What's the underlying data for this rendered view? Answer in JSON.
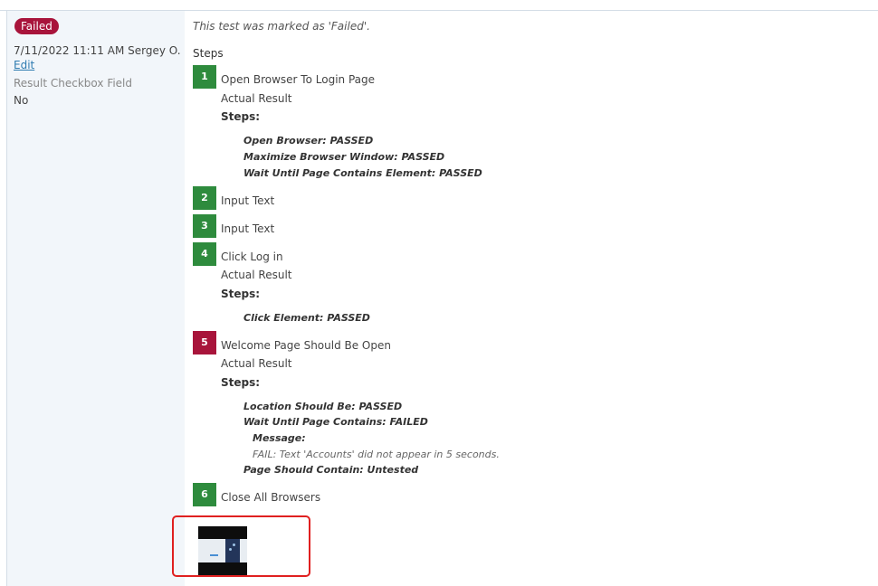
{
  "result": {
    "status_label": "Failed",
    "timestamp_user": "7/11/2022 11:11 AM Sergey O.",
    "edit_label": "Edit",
    "field_label": "Result Checkbox Field",
    "field_value": "No",
    "colors": {
      "failed": "#a8143b",
      "passed": "#2e8b3d"
    }
  },
  "main": {
    "status_note": "This test was marked as 'Failed'.",
    "steps_heading": "Steps",
    "steps": [
      {
        "number": "1",
        "status": "passed",
        "title": "Open Browser To Login Page",
        "actual_label": "Actual Result",
        "steps_label": "Steps:",
        "substeps": [
          "Open Browser: PASSED",
          "Maximize Browser Window: PASSED",
          "Wait Until Page Contains Element: PASSED"
        ]
      },
      {
        "number": "2",
        "status": "passed",
        "title": "Input Text"
      },
      {
        "number": "3",
        "status": "passed",
        "title": "Input Text"
      },
      {
        "number": "4",
        "status": "passed",
        "title": "Click Log in",
        "actual_label": "Actual Result",
        "steps_label": "Steps:",
        "substeps": [
          "Click Element: PASSED"
        ]
      },
      {
        "number": "5",
        "status": "failed",
        "title": "Welcome Page Should Be Open",
        "actual_label": "Actual Result",
        "steps_label": "Steps:",
        "substeps": [
          "Location Should Be: PASSED",
          "Wait Until Page Contains: FAILED",
          "Message:",
          "FAIL: Text 'Accounts' did not appear in 5 seconds.",
          "Page Should Contain: Untested"
        ]
      },
      {
        "number": "6",
        "status": "passed",
        "title": "Close All Browsers"
      }
    ],
    "attachment_icon": "screenshot-thumbnail"
  }
}
